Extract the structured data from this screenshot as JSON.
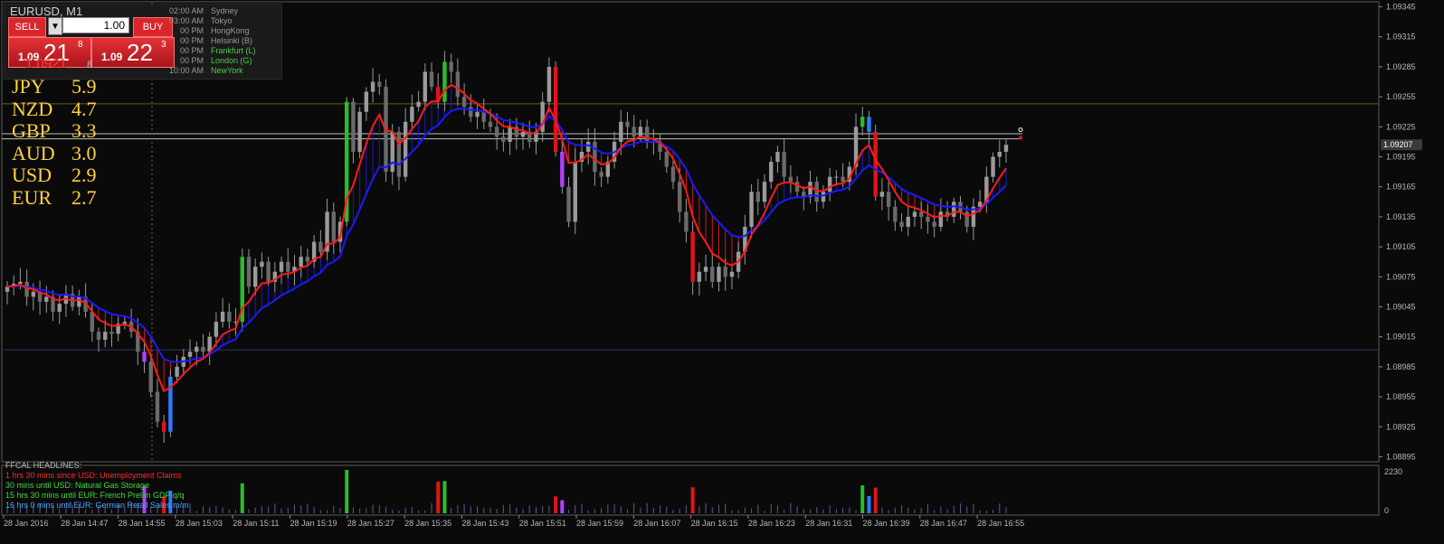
{
  "window": {
    "symbol_title": "EURUSD, M1"
  },
  "trade_panel": {
    "sell_label": "SELL",
    "buy_label": "BUY",
    "lot_value": "1.00",
    "stepper_glyph": "▼",
    "sell_price": {
      "small": "1.09",
      "big": "21",
      "sup": "8"
    },
    "buy_price": {
      "small": "1.09",
      "big": "22",
      "sup": "3"
    },
    "obscured_price": "1.0921",
    "obscured_digit": "8"
  },
  "sessions": [
    {
      "time": "02:00 AM",
      "name": "Sydney",
      "color": "#9a9a9a"
    },
    {
      "time": "03:00 AM",
      "name": "Tokyo",
      "color": "#9a9a9a"
    },
    {
      "time": "00 PM",
      "name": "HongKong",
      "color": "#9a9a9a"
    },
    {
      "time": "00 PM",
      "name": "Helsinki  (B)",
      "color": "#9a9a9a"
    },
    {
      "time": "00 PM",
      "name": "Frankfurt  (L)",
      "color": "#4ccb4c"
    },
    {
      "time": "00 PM",
      "name": "London  (G)",
      "color": "#4ccb4c"
    },
    {
      "time": "10:00 AM",
      "name": "NewYork",
      "color": "#4ccb4c"
    }
  ],
  "strength": [
    {
      "cur": "JPY",
      "val": "5.9"
    },
    {
      "cur": "NZD",
      "val": "4.7"
    },
    {
      "cur": "GBP",
      "val": "3.3"
    },
    {
      "cur": "AUD",
      "val": "3.0"
    },
    {
      "cur": "USD",
      "val": "2.9"
    },
    {
      "cur": "EUR",
      "val": "2.7"
    }
  ],
  "headlines": {
    "title": "FFCAL HEADLINES:",
    "items": [
      {
        "text": "1 hrs 30 mins since USD: Unemployment Claims",
        "color": "#ff2a2a"
      },
      {
        "text": "30 mins until USD: Natural Gas Storage",
        "color": "#3ddc3d"
      },
      {
        "text": "15 hrs 30 mins until EUR: French Prelim GDP q/q",
        "color": "#3ddc3d"
      },
      {
        "text": "16 hrs 0 mins until EUR: German Retail Sales m/m",
        "color": "#4aa8ff"
      }
    ]
  },
  "current_price_label": "1.09207",
  "colors": {
    "bull": "#9a9a9a",
    "red_ma": "#ff1a1a",
    "blue_ma": "#1a1aff",
    "green_candle": "#2bbd2b",
    "red_candle": "#e0141a",
    "purple_candle": "#b040ff",
    "blue_candle": "#2f7bff",
    "axis_text": "#b8b8b8"
  },
  "chart_data": {
    "type": "candlestick",
    "price_axis_ticks": [
      "1.09345",
      "1.09315",
      "1.09285",
      "1.09255",
      "1.09225",
      "1.09195",
      "1.09165",
      "1.09135",
      "1.09105",
      "1.09075",
      "1.09045",
      "1.09015",
      "1.08985",
      "1.08955",
      "1.08925",
      "1.08895"
    ],
    "ylim": [
      1.0889,
      1.0935
    ],
    "time_axis_ticks": [
      "28 Jan 2016",
      "28 Jan 14:47",
      "28 Jan 14:55",
      "28 Jan 15:03",
      "28 Jan 15:11",
      "28 Jan 15:19",
      "28 Jan 15:27",
      "28 Jan 15:35",
      "28 Jan 15:43",
      "28 Jan 15:51",
      "28 Jan 15:59",
      "28 Jan 16:07",
      "28 Jan 16:15",
      "28 Jan 16:23",
      "28 Jan 16:31",
      "28 Jan 16:39",
      "28 Jan 16:47",
      "28 Jan 16:55"
    ],
    "volume_axis_ticks": [
      "2230",
      "0"
    ],
    "volume_max": 2230,
    "close": [
      1.09065,
      1.09068,
      1.0907,
      1.09055,
      1.0906,
      1.0905,
      1.09055,
      1.0904,
      1.09048,
      1.09058,
      1.09045,
      1.09055,
      1.0904,
      1.0902,
      1.09012,
      1.0902,
      1.09018,
      1.09028,
      1.0903,
      1.0902,
      1.09,
      1.0899,
      1.0896,
      1.0893,
      1.0892,
      1.08975,
      1.08985,
      1.08995,
      1.09,
      1.09005,
      1.09,
      1.09015,
      1.0903,
      1.0904,
      1.0903,
      1.0903,
      1.09095,
      1.09065,
      1.09085,
      1.0909,
      1.0907,
      1.0908,
      1.0909,
      1.0908,
      1.09085,
      1.09095,
      1.0909,
      1.0911,
      1.091,
      1.0914,
      1.0911,
      1.0913,
      1.0925,
      1.092,
      1.0924,
      1.0926,
      1.0927,
      1.09265,
      1.0918,
      1.0922,
      1.09175,
      1.0923,
      1.09245,
      1.0925,
      1.0928,
      1.09265,
      1.0925,
      1.0929,
      1.0928,
      1.09255,
      1.09245,
      1.09235,
      1.0924,
      1.0923,
      1.09225,
      1.09215,
      1.0921,
      1.09225,
      1.09215,
      1.0922,
      1.0921,
      1.0922,
      1.0925,
      1.09285,
      1.092,
      1.09165,
      1.0913,
      1.0919,
      1.092,
      1.0921,
      1.0918,
      1.09175,
      1.0919,
      1.0921,
      1.0923,
      1.09225,
      1.09215,
      1.09225,
      1.0921,
      1.0921,
      1.092,
      1.09185,
      1.0917,
      1.0914,
      1.0912,
      1.0907,
      1.0908,
      1.09085,
      1.0907,
      1.09085,
      1.09075,
      1.0908,
      1.091,
      1.09125,
      1.0916,
      1.0915,
      1.0917,
      1.0919,
      1.092,
      1.09175,
      1.0917,
      1.0916,
      1.09155,
      1.0917,
      1.0915,
      1.0916,
      1.09175,
      1.09175,
      1.0917,
      1.09185,
      1.09225,
      1.09235,
      1.0922,
      1.09155,
      1.0916,
      1.09145,
      1.0913,
      1.09125,
      1.09135,
      1.0914,
      1.09135,
      1.0913,
      1.09125,
      1.0914,
      1.09135,
      1.0915,
      1.0914,
      1.09125,
      1.09145,
      1.0915,
      1.09175,
      1.09195,
      1.092,
      1.09207
    ]
  }
}
